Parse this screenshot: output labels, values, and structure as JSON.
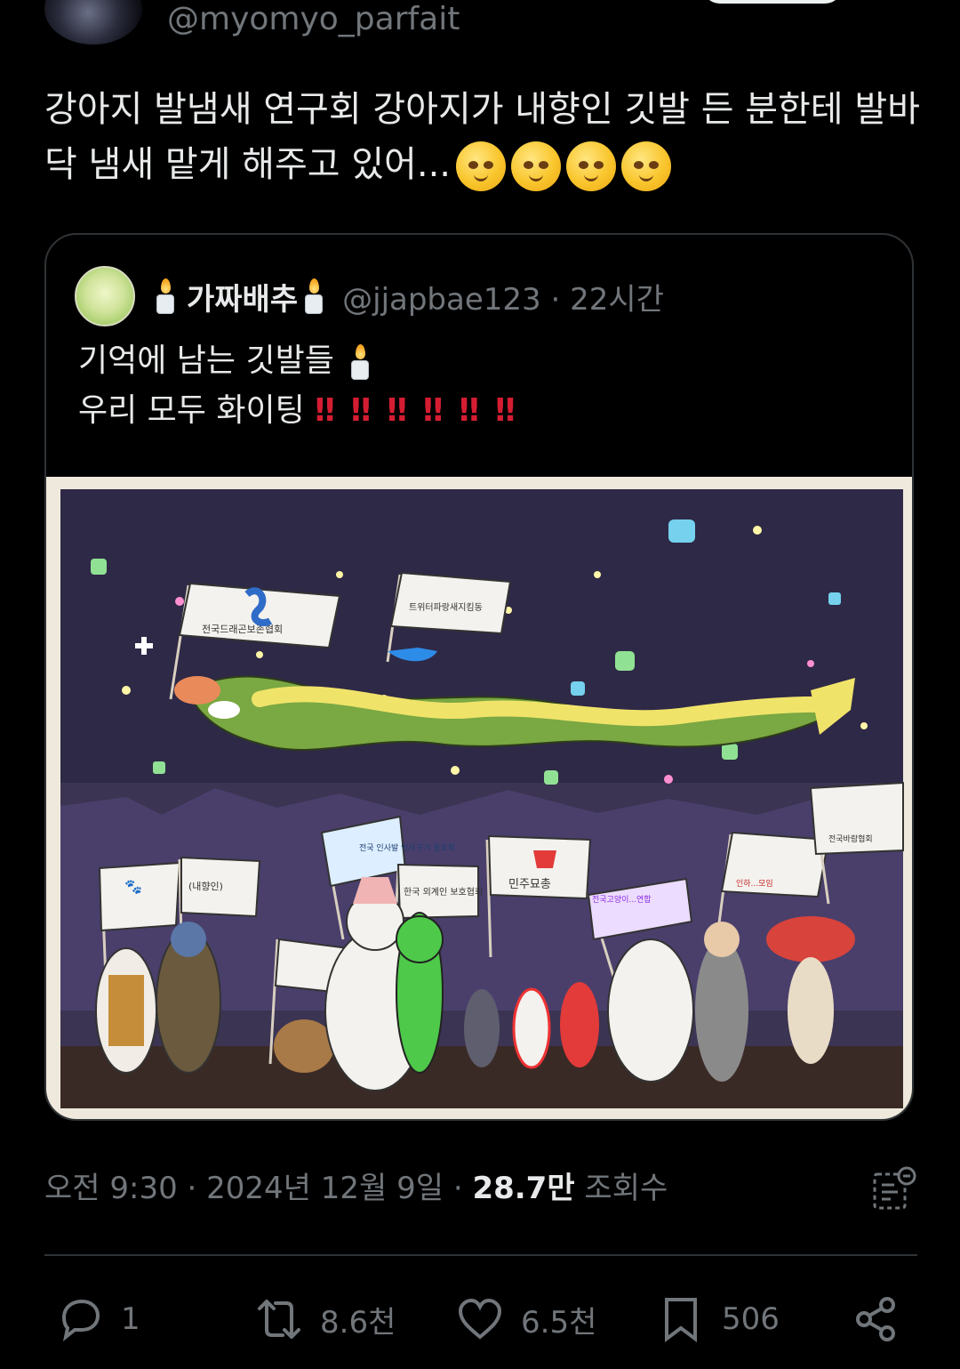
{
  "author": {
    "handle": "@myomyo_parfait"
  },
  "tweet": {
    "text": "강아지 발냄새 연구회 강아지가 내향인 깃발 든 분한테 발바닥 냄새 맡게 해주고 있어..."
  },
  "quoted": {
    "display_name": "가짜배추",
    "handle": "@jjapbae123 · 22시간",
    "line1": "기억에 남는 깃발들",
    "line2": "우리 모두 화이팅",
    "exclamation": "‼",
    "image_flags": [
      "전국드래곤보존협회",
      "트위터파랑새지킴동",
      "전국 인사발 인사구기 동호회",
      "(내향인)",
      "한국 외계인 보호협회",
      "민주묘총",
      "전국고양이...연합",
      "전국바람협회",
      "인하...모임"
    ]
  },
  "meta": {
    "time": "오전 9:30 · 2024년 12월 9일 · ",
    "views_count": "28.7만",
    "views_label": " 조회수"
  },
  "actions": {
    "reply_count": "1",
    "retweet_count": "8.6천",
    "like_count": "6.5천",
    "bookmark_count": "506"
  },
  "colors": {
    "background": "#000000",
    "text": "#e7e9ea",
    "muted": "#71767b",
    "border": "#2f3336",
    "bang": "#d41d32"
  },
  "icons": [
    "reply-icon",
    "retweet-icon",
    "like-icon",
    "bookmark-icon",
    "share-icon",
    "analytics-icon",
    "candle-icon",
    "pleading-face-emoji"
  ]
}
